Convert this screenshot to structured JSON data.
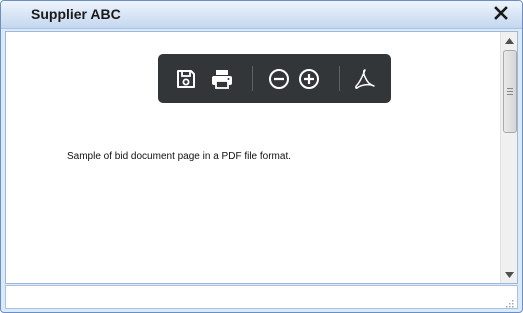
{
  "window": {
    "title": "Supplier ABC",
    "close_icon": "close-icon"
  },
  "pdf_toolbar": {
    "buttons": [
      {
        "name": "save",
        "icon": "save-icon"
      },
      {
        "name": "print",
        "icon": "print-icon"
      },
      {
        "name": "zoom-out",
        "icon": "zoom-out-icon"
      },
      {
        "name": "zoom-in",
        "icon": "zoom-in-icon"
      },
      {
        "name": "open-in-acrobat",
        "icon": "acrobat-icon"
      }
    ]
  },
  "document": {
    "text": "Sample of bid document page in a PDF file format."
  },
  "colors": {
    "toolbar_bg": "#323639",
    "icon_color": "#ffffff",
    "window_border": "#6d8fbf",
    "titlebar_top": "#eef4fc",
    "titlebar_bottom": "#c4d7ef"
  }
}
